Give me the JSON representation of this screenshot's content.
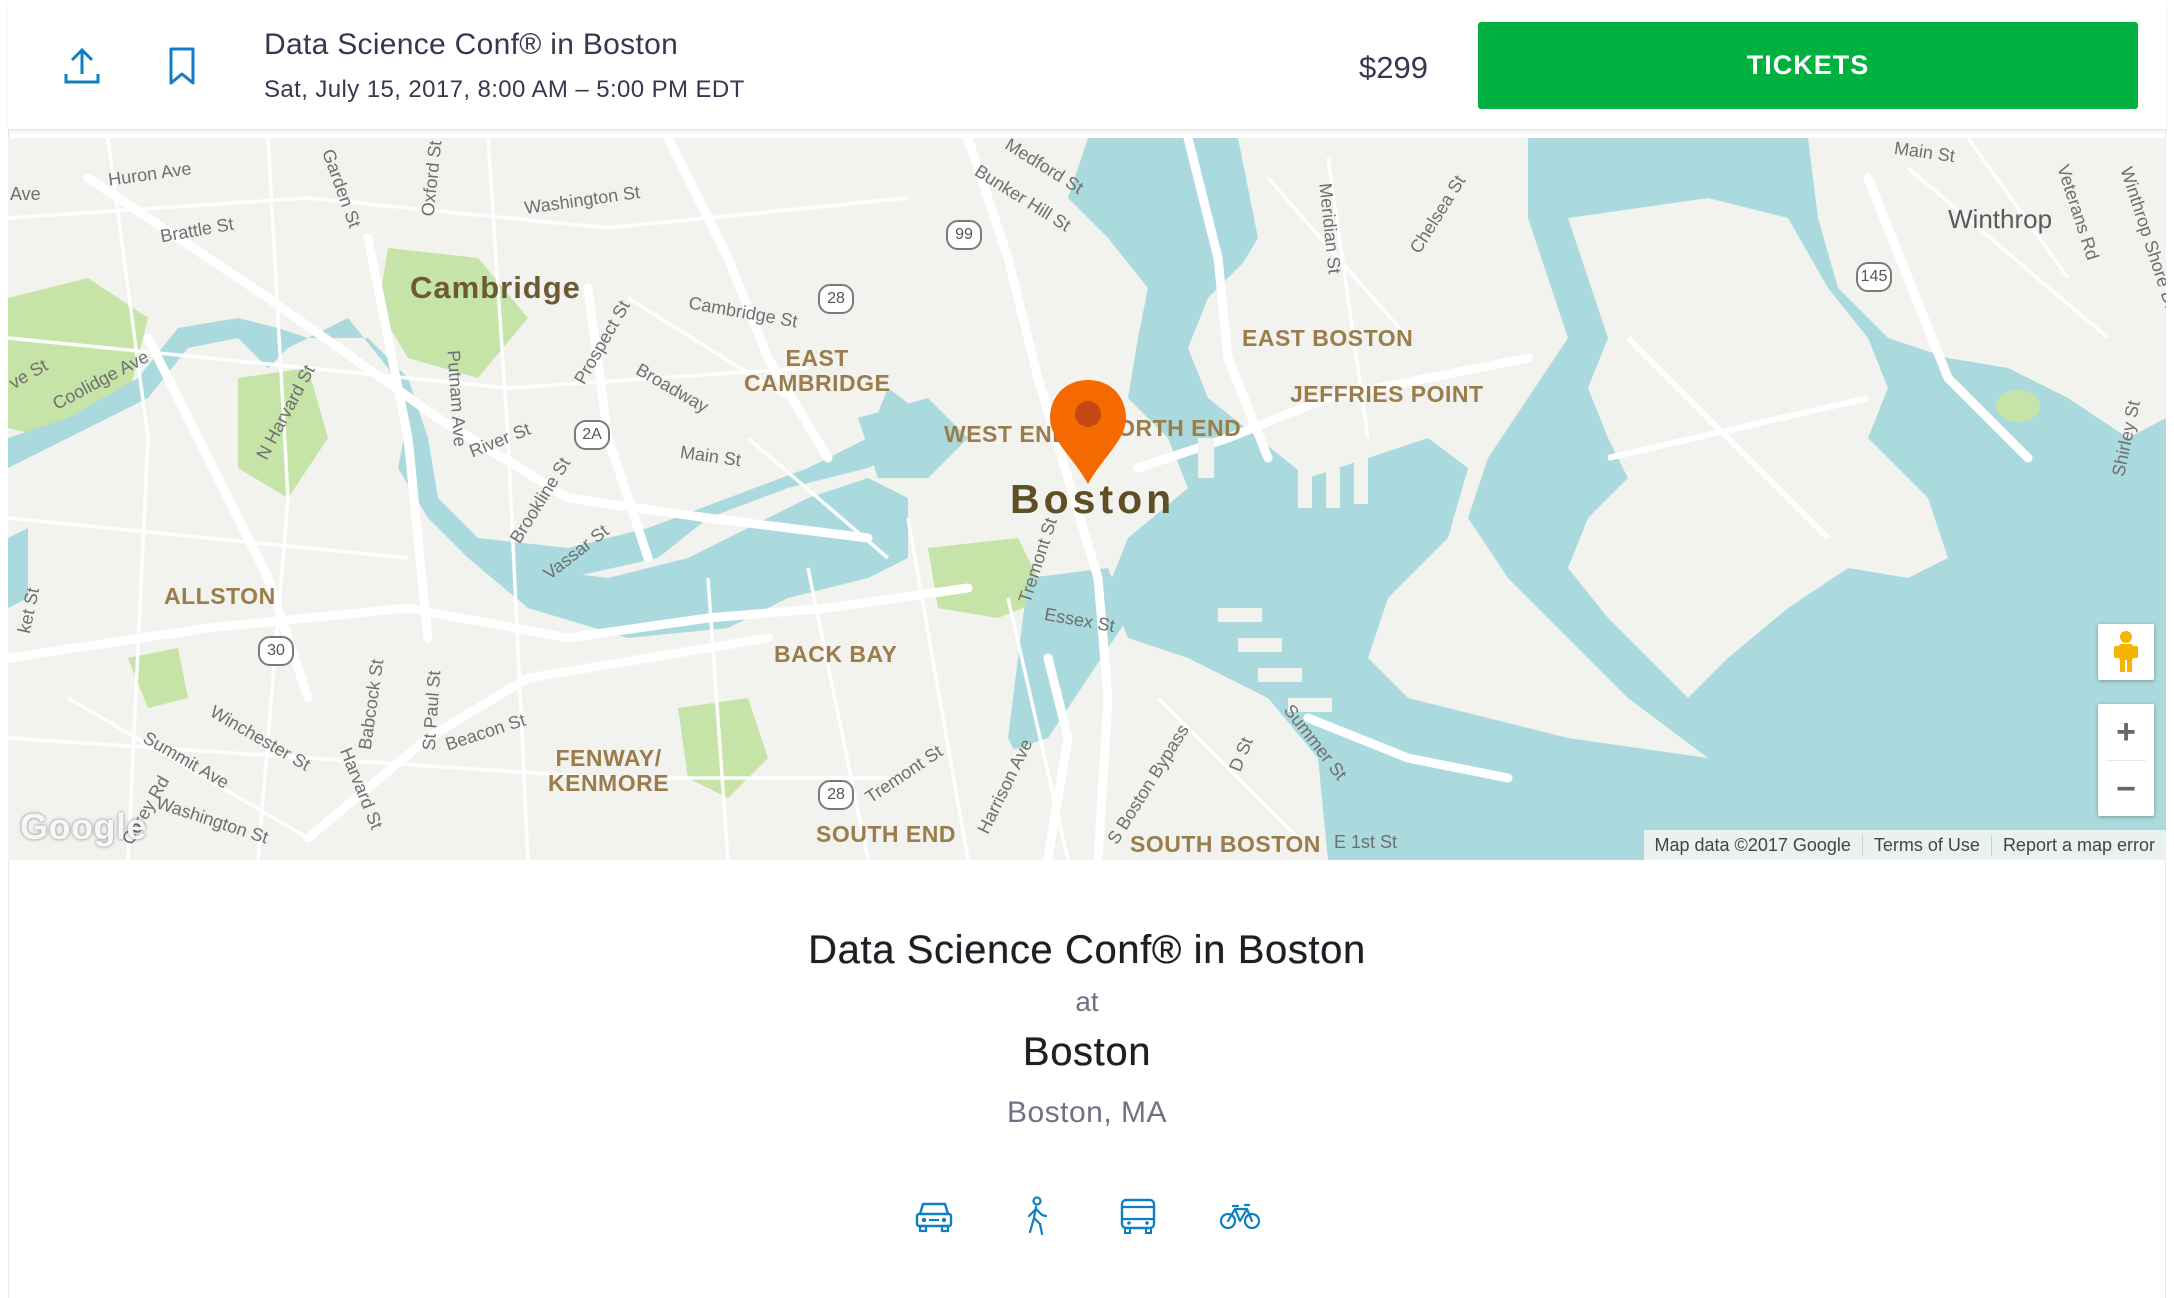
{
  "header": {
    "share_icon": "share-upload-icon",
    "save_icon": "bookmark-icon",
    "event_title": "Data Science Conf® in Boston",
    "event_date": "Sat, July 15, 2017, 8:00 AM – 5:00 PM EDT",
    "price": "$299",
    "tickets_label": "TICKETS",
    "accent_color": "#00b140",
    "icon_color": "#0f7ec3"
  },
  "map": {
    "labels": {
      "cambridge": "Cambridge",
      "boston": "Boston",
      "winthrop": "Winthrop",
      "east_cambridge": "EAST\nCAMBRIDGE",
      "west_end": "WEST END",
      "north_end": "NORTH END",
      "east_boston": "EAST BOSTON",
      "jeffries_point": "JEFFRIES POINT",
      "allston": "ALLSTON",
      "back_bay": "BACK BAY",
      "fenway": "FENWAY/\nKENMORE",
      "south_end": "SOUTH END",
      "south_boston": "SOUTH BOSTON"
    },
    "streets": {
      "huron": "Huron Ave",
      "brattle": "Brattle St",
      "garden": "Garden St",
      "oxford": "Oxford St",
      "washington": "Washington St",
      "medford": "Medford St",
      "bunker": "Bunker Hill St",
      "meridian": "Meridian St",
      "chelsea": "Chelsea St",
      "main_winthrop": "Main St",
      "veterans": "Veterans Rd",
      "winthrop_shore": "Winthrop Shore Dr",
      "coolidge": "Coolidge Ave",
      "n_harvard": "N Harvard St",
      "putnam": "Putnam Ave",
      "prospect": "Prospect St",
      "cambridge_st": "Cambridge St",
      "broadway": "Broadway",
      "river": "River St",
      "brookline": "Brookline St",
      "vassar": "Vassar St",
      "main_cambridge": "Main St",
      "tremont": "Tremont St",
      "essex": "Essex St",
      "shirley": "Shirley St",
      "market": "ket St",
      "winchester": "Winchester St",
      "summit": "Summit Ave",
      "harvard": "Harvard St",
      "babcock": "Babcock St",
      "st_paul": "St Paul St",
      "beacon": "Beacon St",
      "corey": "Corey Rd",
      "washington2": "Washington St",
      "tremont2": "Tremont St",
      "harrison": "Harrison Ave",
      "boston_bypass": "S Boston Bypass",
      "d_st": "D St",
      "summer": "Summer St",
      "e_1st": "E 1st St",
      "ave_left": "Ave",
      "ve_st": "ve St"
    },
    "shields": [
      "99",
      "28",
      "2A",
      "30",
      "28",
      "145"
    ],
    "google_logo": "Google",
    "attribution": {
      "data": "Map data ©2017 Google",
      "terms": "Terms of Use",
      "report": "Report a map error"
    },
    "zoom_in": "+",
    "zoom_out": "−",
    "pin_color": "#f05537",
    "water_color": "#aadadd",
    "park_color": "#c6e3a8"
  },
  "venue": {
    "event_title": "Data Science Conf® in Boston",
    "at": "at",
    "name": "Boston",
    "address": "Boston, MA",
    "transport_icons": [
      "car-icon",
      "walk-icon",
      "bus-icon",
      "bike-icon"
    ]
  }
}
